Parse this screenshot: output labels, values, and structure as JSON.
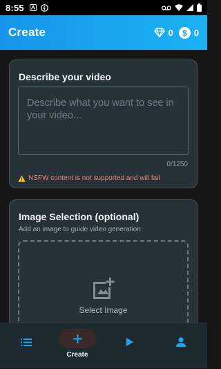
{
  "status": {
    "time": "8:55"
  },
  "header": {
    "title": "Create",
    "gems": "0",
    "coins": "0"
  },
  "describe": {
    "title": "Describe your video",
    "placeholder": "Describe what you want to see in your video...",
    "char_count": "0/1250",
    "warning": "NSFW content is not supported and will fail"
  },
  "image_selection": {
    "title": "Image Selection (optional)",
    "subtitle": "Add an image to guide video generation",
    "select_label": "Select Image"
  },
  "nav": {
    "create_label": "Create"
  },
  "colors": {
    "accent": "#19a5ef",
    "background": "#161616",
    "card": "#263238",
    "warning": "#e98676"
  }
}
